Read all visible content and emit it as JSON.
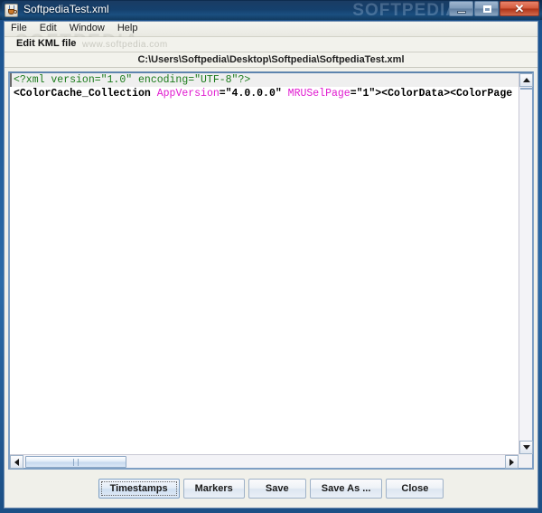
{
  "window": {
    "title": "SoftpediaTest.xml",
    "app_icon": "java-coffee-cup-icon",
    "watermark": "SOFTPEDIA",
    "controls": {
      "minimize": "minimize-button",
      "maximize": "maximize-button",
      "close_label": "✕"
    }
  },
  "menubar": {
    "items": [
      {
        "label": "File"
      },
      {
        "label": "Edit"
      },
      {
        "label": "Window"
      },
      {
        "label": "Help"
      }
    ],
    "watermark": "SOFTPEDIA"
  },
  "subheader": {
    "label": "Edit KML file",
    "watermark": "www.softpedia.com"
  },
  "path": {
    "value": "C:\\Users\\Softpedia\\Desktop\\Softpedia\\SoftpediaTest.xml"
  },
  "editor": {
    "lines": [
      {
        "current": true,
        "tokens": [
          {
            "text": "<?xml version=\"1.0\" encoding=\"UTF-8\"?>",
            "type": "pi"
          }
        ]
      },
      {
        "current": false,
        "tokens": [
          {
            "text": "<ColorCache_Collection ",
            "type": "tag"
          },
          {
            "text": "AppVersion",
            "type": "attr"
          },
          {
            "text": "=\"4.0.0.0\" ",
            "type": "val"
          },
          {
            "text": "MRUSelPage",
            "type": "attr"
          },
          {
            "text": "=\"1\"><ColorData><ColorPage",
            "type": "val"
          }
        ]
      }
    ],
    "colors": {
      "processing_instruction": "#1a7a1a",
      "tag": "#000000",
      "attribute": "#e01ad0",
      "value": "#000000",
      "background": "#ffffff",
      "current_line": "#efefef"
    }
  },
  "scrollbars": {
    "vertical": {
      "up": "▲",
      "down": "▼"
    },
    "horizontal": {
      "left": "◀",
      "right": "▶",
      "thumb_position_pct": 3
    }
  },
  "buttons": [
    {
      "label": "Timestamps",
      "focused": true
    },
    {
      "label": "Markers",
      "focused": false
    },
    {
      "label": "Save",
      "focused": false
    },
    {
      "label": "Save As ...",
      "focused": false
    },
    {
      "label": "Close",
      "focused": false
    }
  ]
}
